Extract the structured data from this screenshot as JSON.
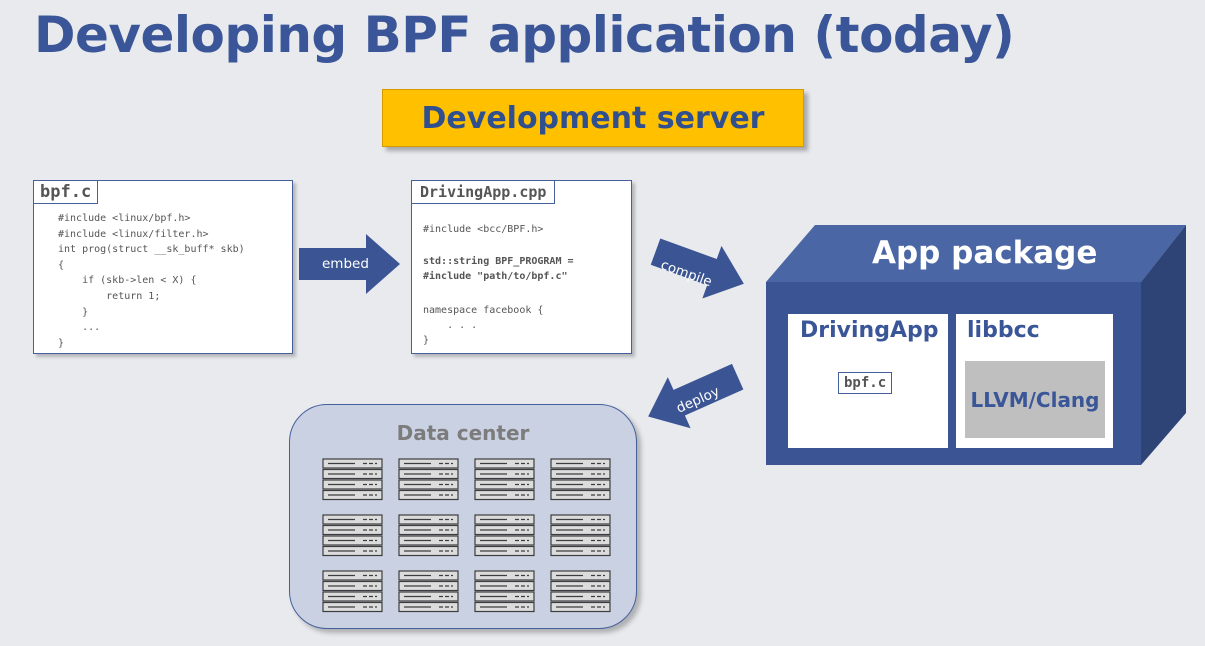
{
  "title": "Developing BPF application (today)",
  "dev_server_label": "Development server",
  "bpf_file": {
    "name": "bpf.c",
    "code": [
      "#include <linux/bpf.h>",
      "#include <linux/filter.h>",
      "int prog(struct __sk_buff* skb)",
      "{",
      "    if (skb->len < X) {",
      "        return 1;",
      "    }",
      "    ...",
      "}"
    ]
  },
  "app_file": {
    "name": "DrivingApp.cpp",
    "line1": "#include <bcc/BPF.h>",
    "line2": "std::string BPF_PROGRAM =",
    "line3": "#include \"path/to/bpf.c\"",
    "line4": "namespace facebook {",
    "line5": "    . . .",
    "line6": "}"
  },
  "arrows": {
    "embed": "embed",
    "compile": "compile",
    "deploy": "deploy"
  },
  "data_center": {
    "label": "Data center",
    "rows": 3,
    "cols": 4
  },
  "app_package": {
    "label": "App package",
    "driving_app": "DrivingApp",
    "bpf_tag": "bpf.c",
    "libbcc": "libbcc",
    "llvm": "LLVM/Clang"
  },
  "colors": {
    "title": "#3a5698",
    "arrow": "#3b5594",
    "package_front": "#3b5594",
    "package_top": "#4a66a5",
    "package_side": "#2e4477",
    "highlight": "#ffc000",
    "background": "#e9eaee"
  }
}
